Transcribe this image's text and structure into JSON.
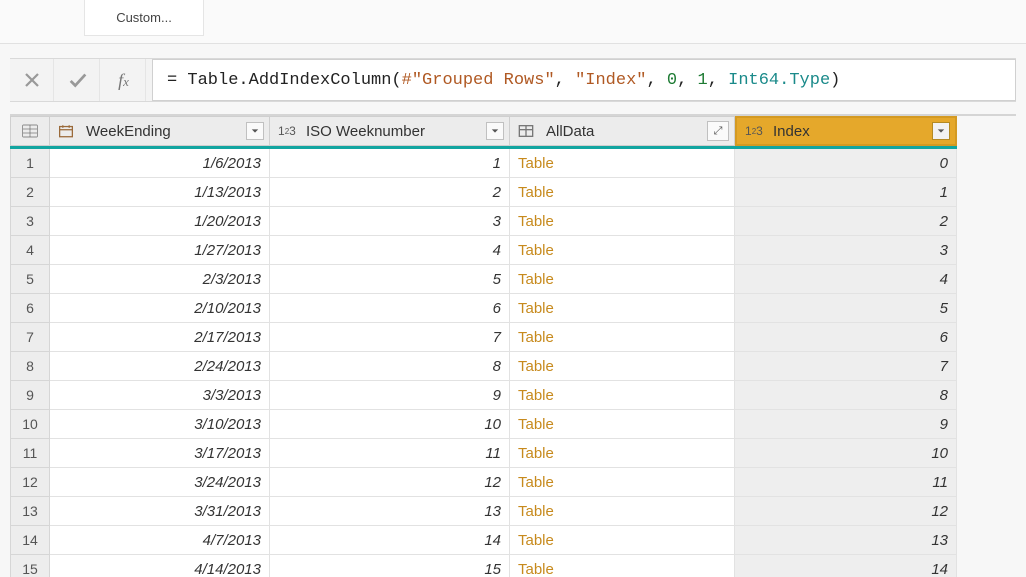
{
  "ribbon": {
    "custom_label": "Custom..."
  },
  "formula_bar": {
    "full": "= Table.AddIndexColumn(#\"Grouped Rows\", \"Index\", 0, 1, Int64.Type)",
    "prefix": "= Table.AddIndexColumn(",
    "arg1": "#\"Grouped Rows\"",
    "sep1": ", ",
    "arg2": "\"Index\"",
    "sep2": ", ",
    "arg3": "0",
    "sep3": ", ",
    "arg4": "1",
    "sep4": ", ",
    "arg5": "Int64.Type",
    "suffix": ")"
  },
  "columns": {
    "c1": "WeekEnding",
    "c2": "ISO Weeknumber",
    "c3": "AllData",
    "c4": "Index",
    "num_prefix": "1",
    "num_sup": "2",
    "num_suffix": "3"
  },
  "rows": [
    {
      "n": "1",
      "week": "1/6/2013",
      "iso": "1",
      "all": "Table",
      "idx": "0"
    },
    {
      "n": "2",
      "week": "1/13/2013",
      "iso": "2",
      "all": "Table",
      "idx": "1"
    },
    {
      "n": "3",
      "week": "1/20/2013",
      "iso": "3",
      "all": "Table",
      "idx": "2"
    },
    {
      "n": "4",
      "week": "1/27/2013",
      "iso": "4",
      "all": "Table",
      "idx": "3"
    },
    {
      "n": "5",
      "week": "2/3/2013",
      "iso": "5",
      "all": "Table",
      "idx": "4"
    },
    {
      "n": "6",
      "week": "2/10/2013",
      "iso": "6",
      "all": "Table",
      "idx": "5"
    },
    {
      "n": "7",
      "week": "2/17/2013",
      "iso": "7",
      "all": "Table",
      "idx": "6"
    },
    {
      "n": "8",
      "week": "2/24/2013",
      "iso": "8",
      "all": "Table",
      "idx": "7"
    },
    {
      "n": "9",
      "week": "3/3/2013",
      "iso": "9",
      "all": "Table",
      "idx": "8"
    },
    {
      "n": "10",
      "week": "3/10/2013",
      "iso": "10",
      "all": "Table",
      "idx": "9"
    },
    {
      "n": "11",
      "week": "3/17/2013",
      "iso": "11",
      "all": "Table",
      "idx": "10"
    },
    {
      "n": "12",
      "week": "3/24/2013",
      "iso": "12",
      "all": "Table",
      "idx": "11"
    },
    {
      "n": "13",
      "week": "3/31/2013",
      "iso": "13",
      "all": "Table",
      "idx": "12"
    },
    {
      "n": "14",
      "week": "4/7/2013",
      "iso": "14",
      "all": "Table",
      "idx": "13"
    },
    {
      "n": "15",
      "week": "4/14/2013",
      "iso": "15",
      "all": "Table",
      "idx": "14"
    }
  ]
}
